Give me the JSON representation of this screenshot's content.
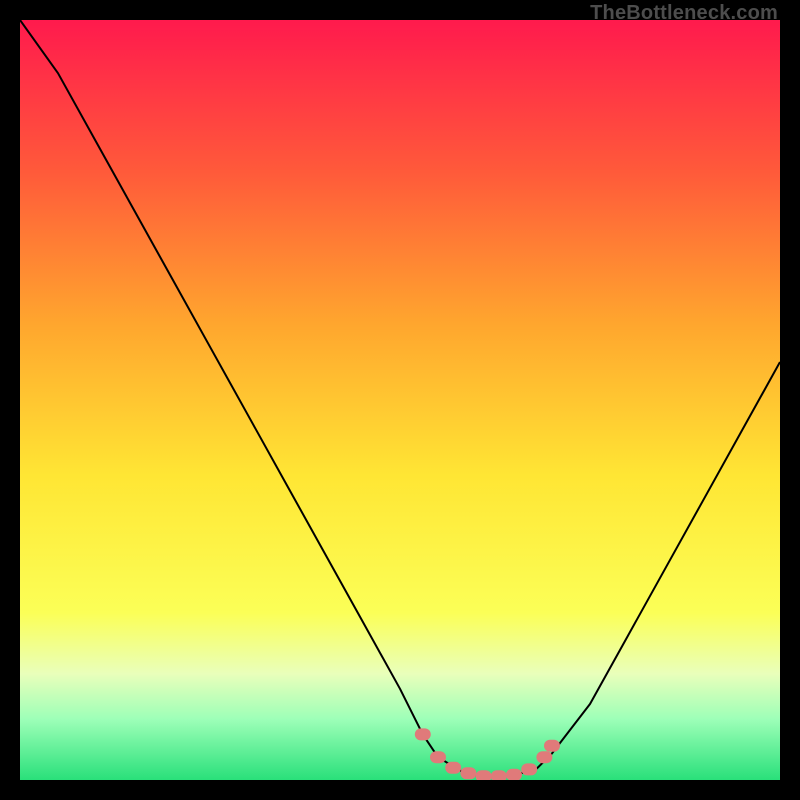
{
  "watermark": "TheBottleneck.com",
  "chart_data": {
    "type": "line",
    "title": "",
    "xlabel": "",
    "ylabel": "",
    "xlim": [
      0,
      100
    ],
    "ylim": [
      0,
      100
    ],
    "series": [
      {
        "name": "bottleneck-curve",
        "x": [
          0,
          5,
          10,
          15,
          20,
          25,
          30,
          35,
          40,
          45,
          50,
          53,
          55,
          58,
          60,
          62,
          65,
          68,
          70,
          75,
          80,
          85,
          90,
          95,
          100
        ],
        "y": [
          100,
          93,
          84,
          75,
          66,
          57,
          48,
          39,
          30,
          21,
          12,
          6,
          3,
          1.2,
          0.6,
          0.4,
          0.6,
          1.5,
          3.5,
          10,
          19,
          28,
          37,
          46,
          55
        ]
      },
      {
        "name": "marker-dots",
        "x": [
          53,
          55,
          57,
          59,
          61,
          63,
          65,
          67,
          69,
          70
        ],
        "y": [
          6,
          3,
          1.6,
          0.9,
          0.5,
          0.5,
          0.7,
          1.4,
          3,
          4.5
        ]
      }
    ],
    "gradient_stops": [
      {
        "offset": 0.0,
        "color": "#ff1a4d"
      },
      {
        "offset": 0.2,
        "color": "#ff5a3a"
      },
      {
        "offset": 0.4,
        "color": "#ffa62e"
      },
      {
        "offset": 0.6,
        "color": "#ffe634"
      },
      {
        "offset": 0.78,
        "color": "#fbff57"
      },
      {
        "offset": 0.86,
        "color": "#e9ffba"
      },
      {
        "offset": 0.92,
        "color": "#9dffb8"
      },
      {
        "offset": 1.0,
        "color": "#29e07a"
      }
    ],
    "marker_color": "#e07a7a",
    "curve_color": "#000000"
  }
}
